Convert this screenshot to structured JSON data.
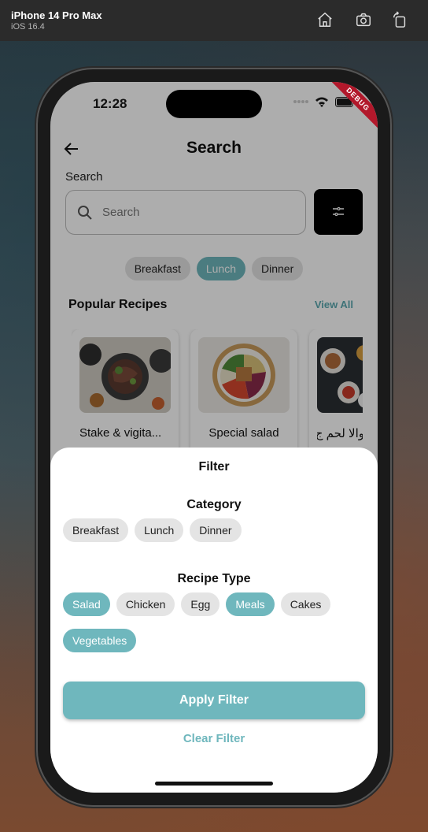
{
  "simulator": {
    "device": "iPhone 14 Pro Max",
    "os": "iOS 16.4"
  },
  "status_bar": {
    "time": "12:28",
    "debug_banner": "DEBUG"
  },
  "header": {
    "title": "Search"
  },
  "search": {
    "label": "Search",
    "placeholder": "Search"
  },
  "meal_tabs": [
    {
      "label": "Breakfast",
      "active": false
    },
    {
      "label": "Lunch",
      "active": true
    },
    {
      "label": "Dinner",
      "active": false
    }
  ],
  "popular": {
    "title": "Popular Recipes",
    "view_all": "View All",
    "cards": [
      {
        "name": "Stake & vigita..."
      },
      {
        "name": "Special salad"
      },
      {
        "name": "والا لحم ج"
      }
    ]
  },
  "filter_sheet": {
    "title": "Filter",
    "category_title": "Category",
    "categories": [
      {
        "label": "Breakfast",
        "selected": false
      },
      {
        "label": "Lunch",
        "selected": false
      },
      {
        "label": "Dinner",
        "selected": false
      }
    ],
    "recipe_type_title": "Recipe Type",
    "recipe_types": [
      {
        "label": "Salad",
        "selected": true
      },
      {
        "label": "Chicken",
        "selected": false
      },
      {
        "label": "Egg",
        "selected": false
      },
      {
        "label": "Meals",
        "selected": true
      },
      {
        "label": "Cakes",
        "selected": false
      },
      {
        "label": "Vegetables",
        "selected": true
      }
    ],
    "apply_label": "Apply Filter",
    "clear_label": "Clear Filter"
  },
  "colors": {
    "accent": "#6fb7bd",
    "chip_bg": "#e4e4e4",
    "debug": "#b2182b"
  }
}
